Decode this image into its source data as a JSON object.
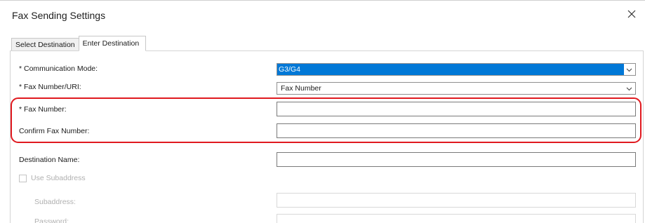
{
  "window": {
    "title": "Fax Sending Settings",
    "close_icon": "close-icon"
  },
  "tabs": [
    {
      "label": "Select Destination",
      "active": false
    },
    {
      "label": "Enter Destination",
      "active": true
    }
  ],
  "form": {
    "communication_mode": {
      "label": "* Communication Mode:",
      "value": "G3/G4"
    },
    "fax_number_uri": {
      "label": "* Fax Number/URI:",
      "value": "Fax Number"
    },
    "fax_number": {
      "label": "* Fax Number:",
      "value": ""
    },
    "confirm_fax_number": {
      "label": "Confirm Fax Number:",
      "value": ""
    },
    "destination_name": {
      "label": "Destination Name:",
      "value": ""
    },
    "use_subaddress": {
      "label": "Use Subaddress",
      "checked": false
    },
    "subaddress": {
      "label": "Subaddress:",
      "value": ""
    },
    "password": {
      "label": "Password:",
      "value": ""
    }
  },
  "colors": {
    "selection": "#0078d7",
    "callout": "#e0191f"
  }
}
